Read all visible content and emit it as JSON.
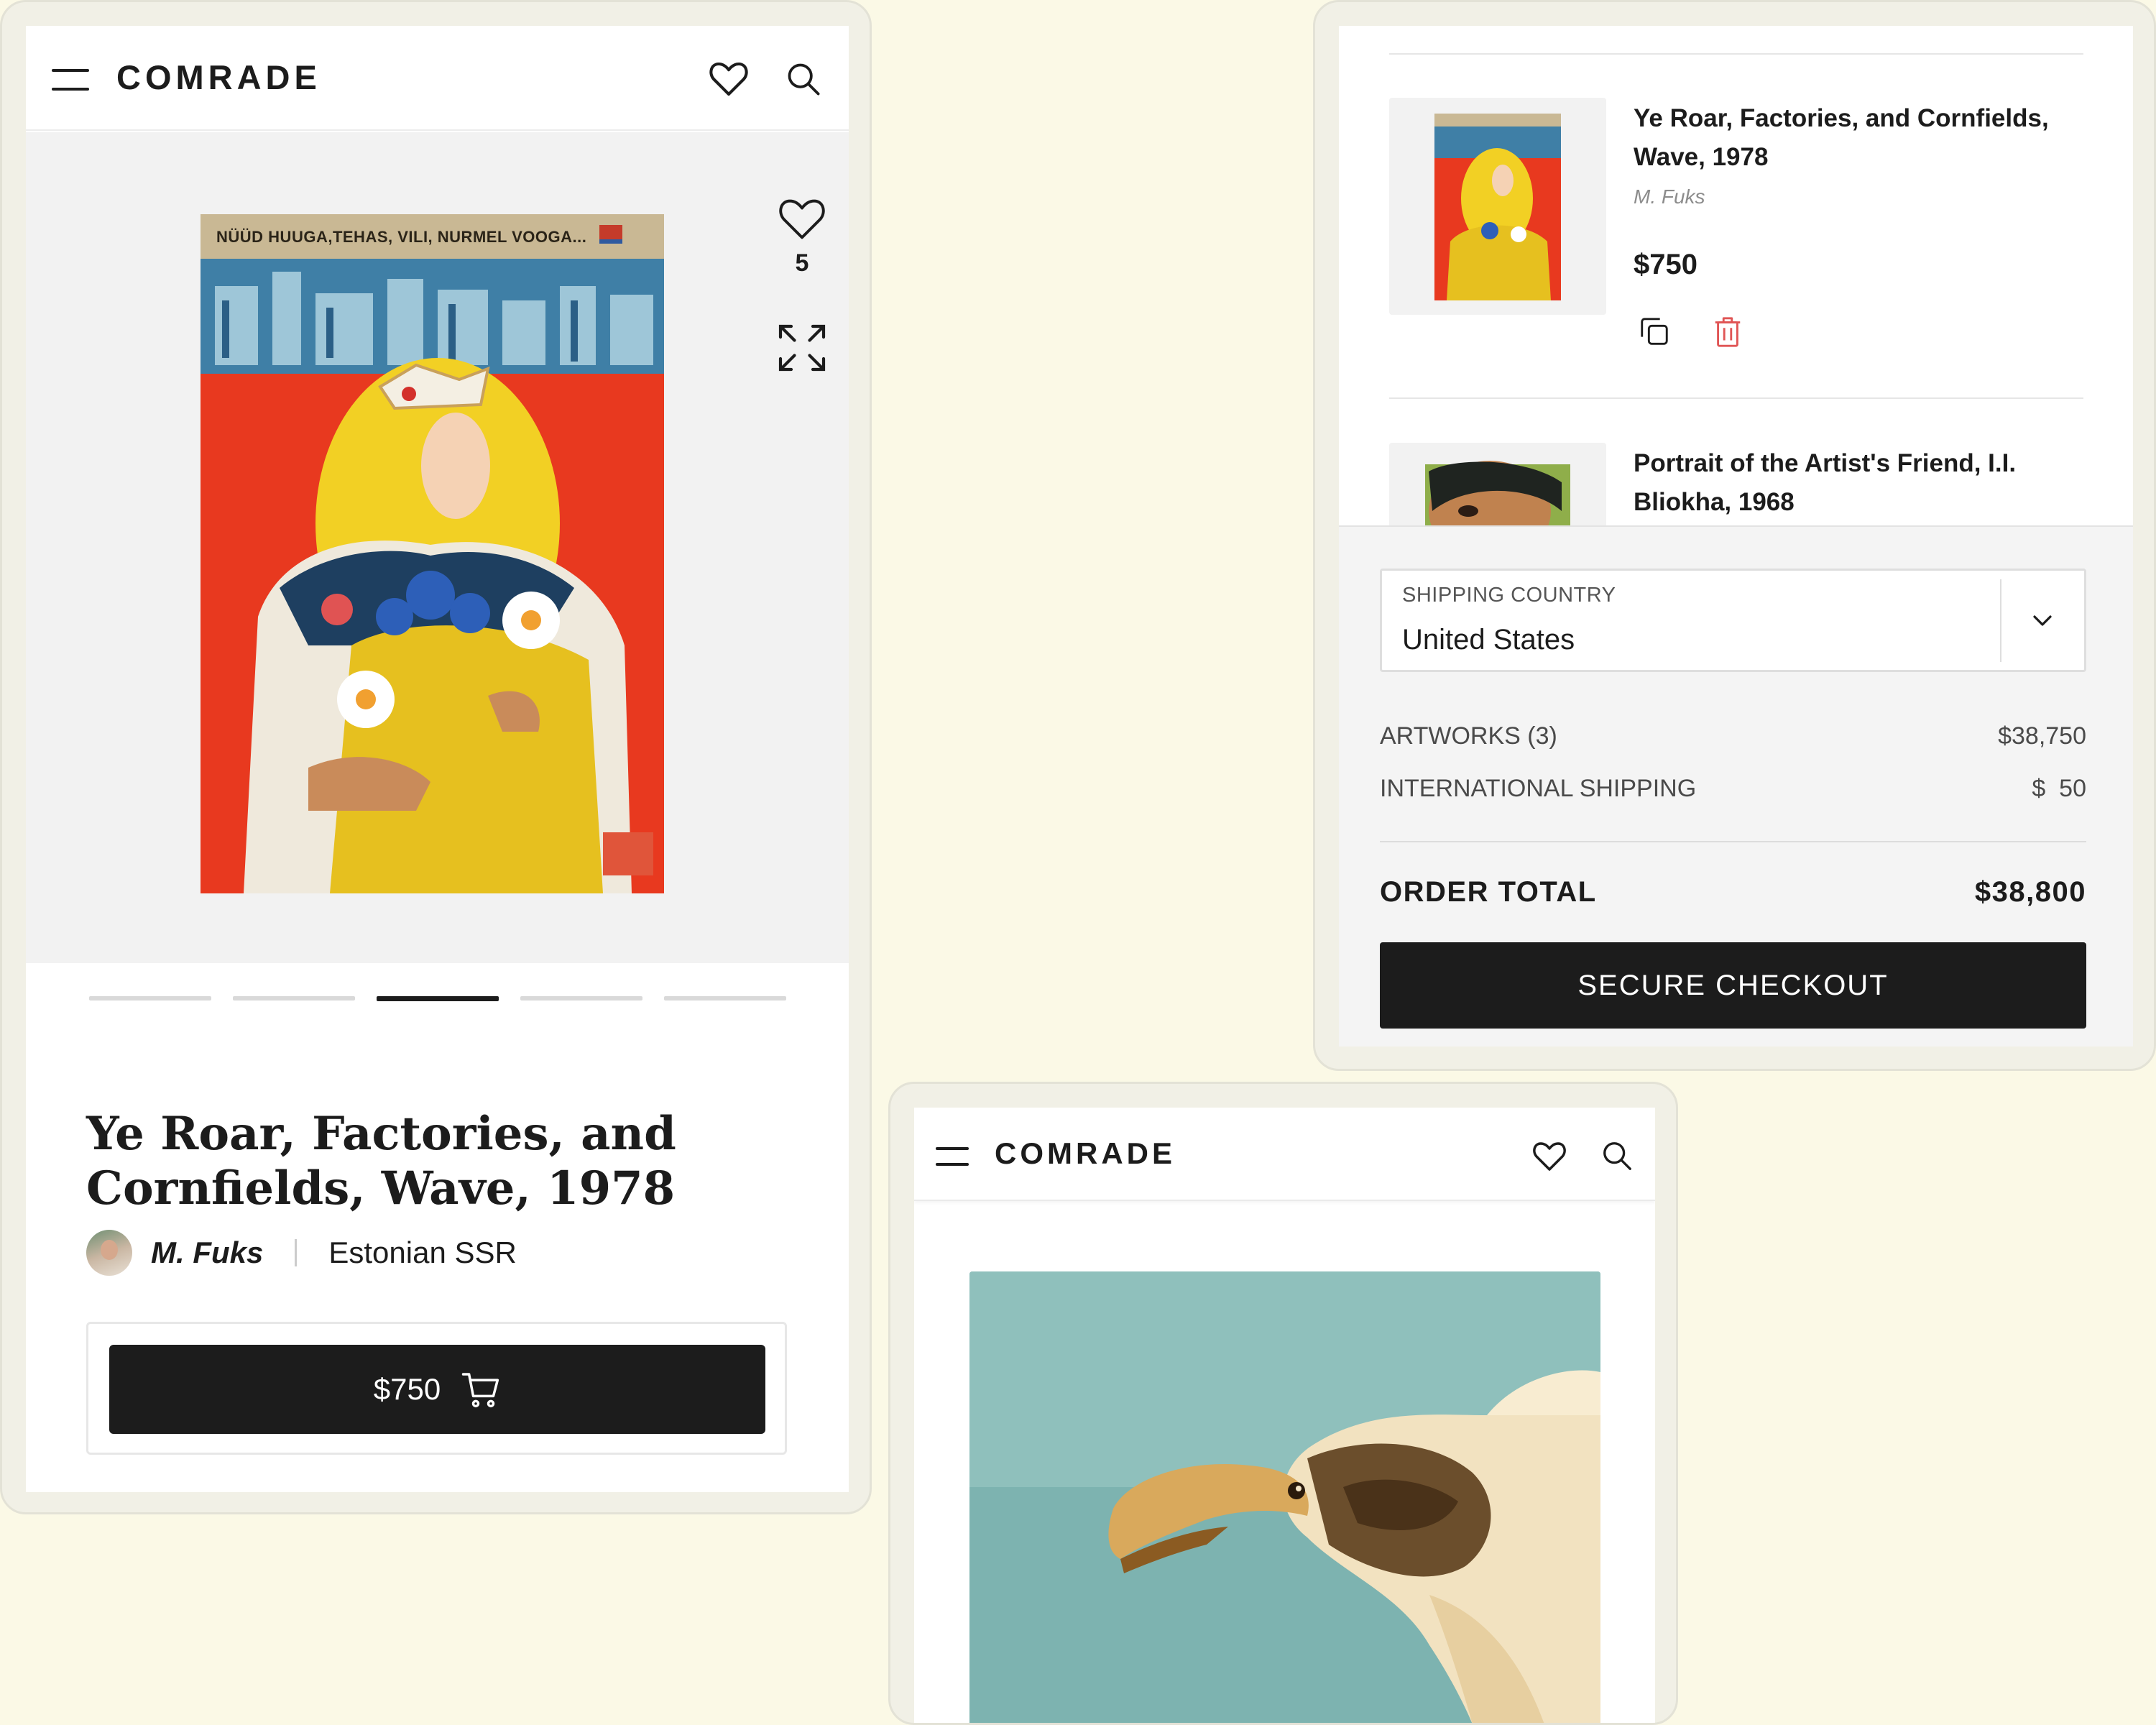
{
  "brand": "COMRADE",
  "product": {
    "poster_caption": "NÜÜD HUUGA,TEHAS, VILI, NURMEL VOOGA...",
    "favorites_count": "5",
    "title": "Ye Roar, Factories, and Cornfields, Wave, 1978",
    "artist": "M. Fuks",
    "origin": "Estonian SSR",
    "price": "$750",
    "carousel": {
      "count": 5,
      "active_index": 3
    }
  },
  "cart": {
    "items": [
      {
        "title": "Ye Roar, Factories, and Cornfields, Wave, 1978",
        "artist": "M. Fuks",
        "price": "$750"
      },
      {
        "title": "Portrait of the Artist's Friend, I.I. Bliokha, 1968"
      }
    ],
    "shipping_country_label": "SHIPPING COUNTRY",
    "shipping_country_value": "United States",
    "artworks_label": "ARTWORKS (3)",
    "artworks_value": "$38,750",
    "shipping_label": "INTERNATIONAL SHIPPING",
    "shipping_value": "$  50",
    "total_label": "ORDER TOTAL",
    "total_value": "$38,800",
    "checkout_label": "SECURE CHECKOUT"
  },
  "colors": {
    "background": "#fbf9e6",
    "button": "#1c1c1c",
    "poster_red": "#e8391f",
    "delete_icon": "#e05555",
    "sky_teal": "#7db3b0"
  }
}
